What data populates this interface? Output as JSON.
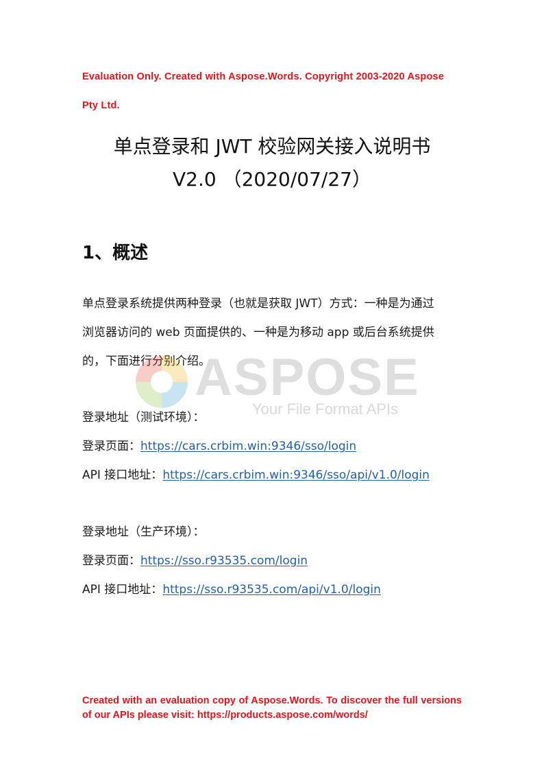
{
  "eval_notice": {
    "line1": "Evaluation Only. Created with Aspose.Words. Copyright 2003-2020 Aspose",
    "line2": "Pty Ltd."
  },
  "title": {
    "main": "单点登录和 JWT 校验网关接入说明书",
    "version": "V2.0 （2020/07/27）"
  },
  "section1": {
    "heading": "1、概述",
    "intro_lines": [
      "单点登录系统提供两种登录（也就是获取 JWT）方式：一种是为通过",
      "浏览器访问的 web 页面提供的、一种是为移动 app 或后台系统提供",
      "的，下面进行分别介绍。"
    ]
  },
  "test_env": {
    "label": "登录地址（测试环境）：",
    "login_label": "登录页面：",
    "login_url": "https://cars.crbim.win:9346/sso/login",
    "api_label": "API 接口地址：",
    "api_url": "https://cars.crbim.win:9346/sso/api/v1.0/login"
  },
  "prod_env": {
    "label": "登录地址（生产环境）：",
    "login_label": "登录页面：",
    "login_url": "https://sso.r93535.com/login",
    "api_label": "API 接口地址：",
    "api_url": "https://sso.r93535.com/api/v1.0/login"
  },
  "footer_notice": "Created with an evaluation copy of Aspose.Words. To discover the full versions of our APIs please visit: https://products.aspose.com/words/",
  "watermark": {
    "word": "ASPOSE",
    "tagline": "Your File Format APIs"
  },
  "colors": {
    "notice_red": "#e8121b",
    "link_blue": "#1f5fb0"
  }
}
